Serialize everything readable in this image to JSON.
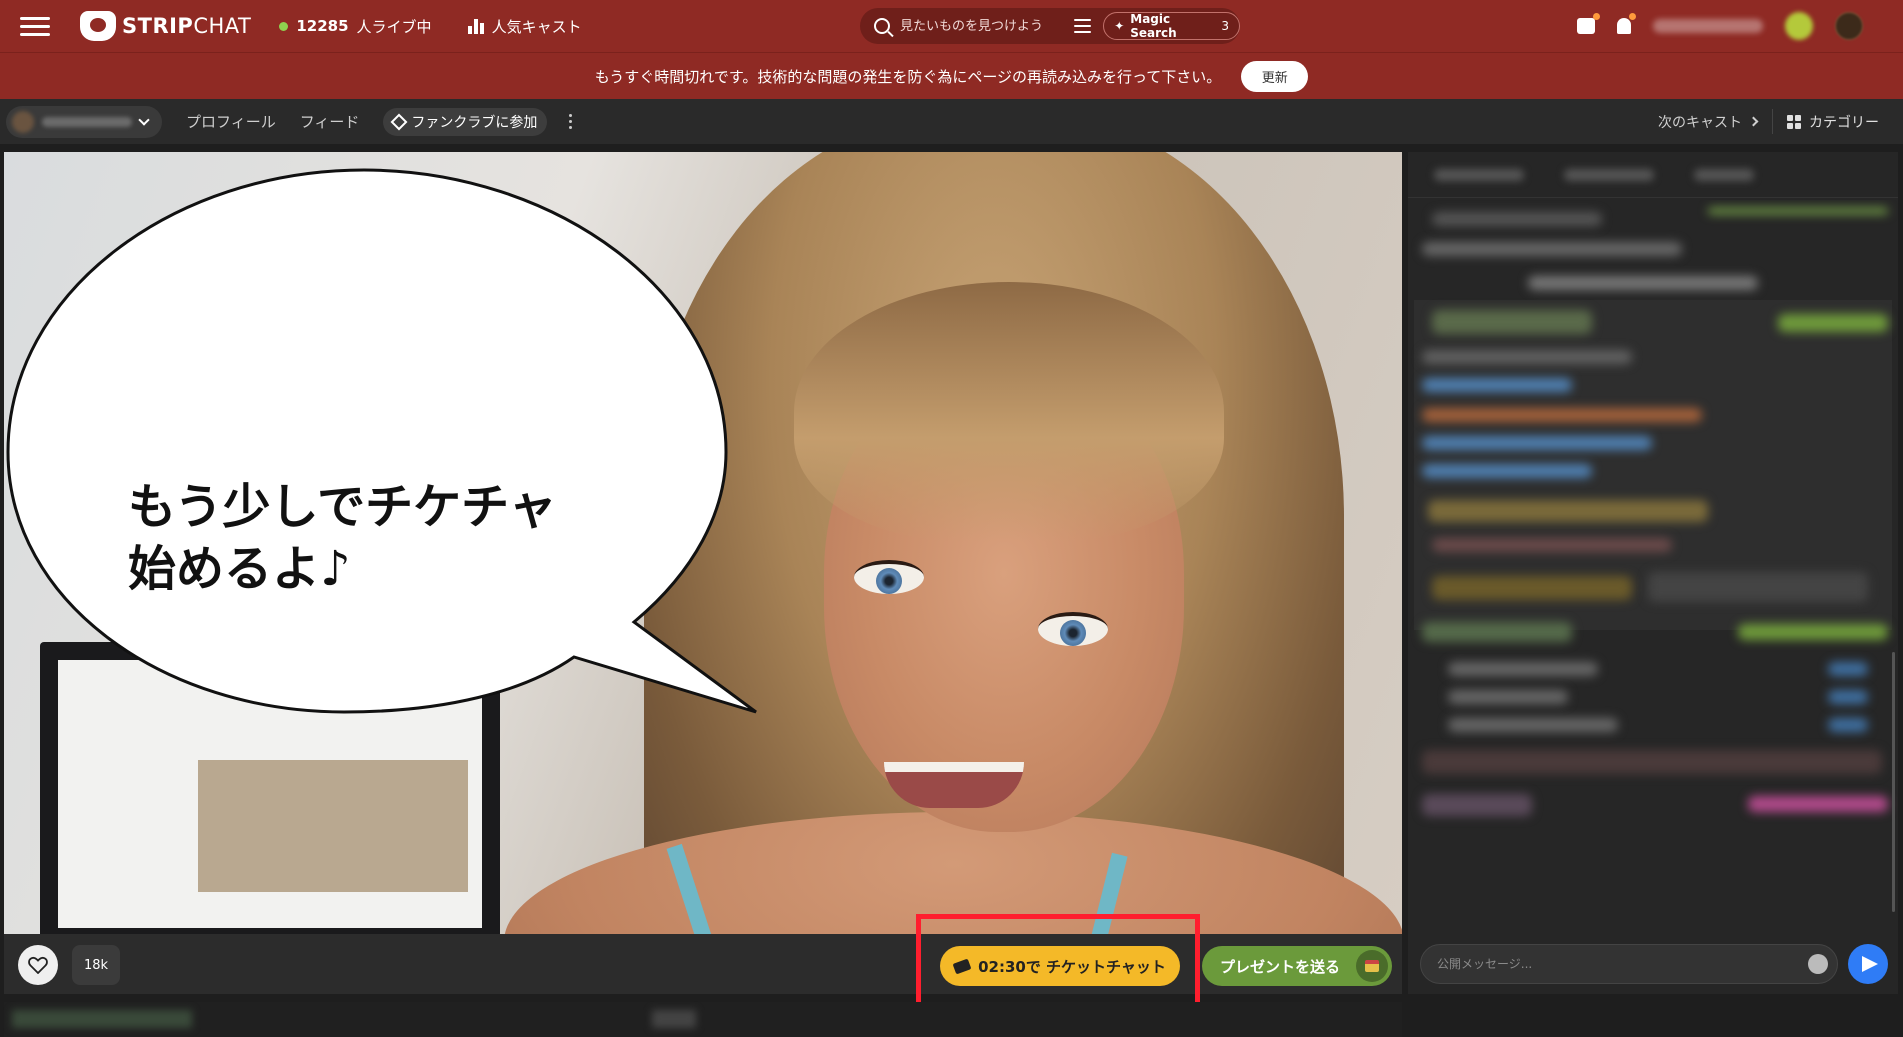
{
  "header": {
    "logo_text_a": "STRIP",
    "logo_text_b": "CHAT",
    "live_count": "12285",
    "live_label": "人ライブ中",
    "popular_label": "人気キャスト",
    "search_placeholder": "見たいものを見つけよう",
    "magic_label": "Magic Search",
    "magic_count": "3"
  },
  "notice": {
    "message": "もうすぐ時間切れです。技術的な問題の発生を防ぐ為にページの再読み込みを行って下さい。",
    "button": "更新"
  },
  "subnav": {
    "profile": "プロフィール",
    "feed": "フィード",
    "fanclub": "ファンクラブに参加",
    "next_cast": "次のキャスト",
    "category": "カテゴリー"
  },
  "video": {
    "bubble_text": "もう少しでチケチャ\n始めるよ♪"
  },
  "controls": {
    "likes": "18k",
    "ticket_time": "02:30",
    "ticket_label": "で チケットチャット",
    "gift_label": "プレゼントを送る"
  },
  "chat": {
    "input_placeholder": "公開メッセージ..."
  },
  "colors": {
    "header_bg": "#8f2a24",
    "ticket_btn": "#f4b928",
    "gift_btn": "#6b9a3b",
    "highlight": "#ff1e2e",
    "send_btn": "#2f7cf6"
  }
}
